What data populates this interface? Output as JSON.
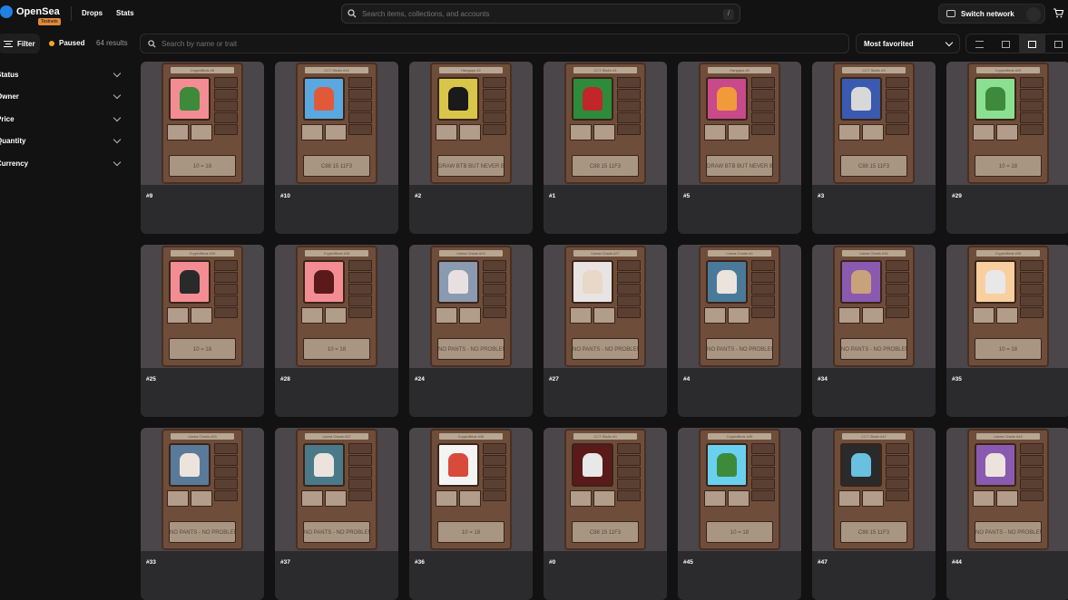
{
  "header": {
    "brand": "OpenSea",
    "badge": "Testnets",
    "nav": [
      "Drops",
      "Stats"
    ],
    "search_placeholder": "Search items, collections, and accounts",
    "search_shortcut": "/",
    "switch_network": "Switch network"
  },
  "toolbar": {
    "filter_label": "Filter",
    "status_label": "Paused",
    "results": "64 results",
    "search_placeholder": "Search by name or trait",
    "sort_label": "Most favorited",
    "status_color": "#f5a623"
  },
  "sidebar": {
    "items": [
      "Status",
      "Owner",
      "Price",
      "Quantity",
      "Currency"
    ]
  },
  "items": [
    {
      "name": "#9",
      "title": "CryptoBirdz #9",
      "plate": "10 = 18",
      "bg": "#f48c94",
      "fig": "#3d8a3a"
    },
    {
      "name": "#10",
      "title": "CCT Skullz #10",
      "plate": "C88 15 11F3",
      "bg": "#5aa8e0",
      "fig": "#e05a3a"
    },
    {
      "name": "#2",
      "title": "Hangups #2",
      "plate": "DRAW BTB BUT NEVER BONE",
      "bg": "#d8c64a",
      "fig": "#1a1a1a"
    },
    {
      "name": "#1",
      "title": "CCT Skullz #1",
      "plate": "C88 15 11F3",
      "bg": "#2e8b3a",
      "fig": "#c0262a"
    },
    {
      "name": "#5",
      "title": "Hangups #5",
      "plate": "DRAW BTB BUT NEVER BONE",
      "bg": "#c84a8a",
      "fig": "#f09a3a"
    },
    {
      "name": "#3",
      "title": "CCT Skullz #3",
      "plate": "C88 15 11F3",
      "bg": "#3a5ab0",
      "fig": "#d8d8d8"
    },
    {
      "name": "#29",
      "title": "CryptoBirdz #29",
      "plate": "10 = 18",
      "bg": "#8ae090",
      "fig": "#3d8a3a"
    },
    {
      "name": "#25",
      "title": "CryptoBirdz #25",
      "plate": "10 = 18",
      "bg": "#f48c94",
      "fig": "#2a2a2a"
    },
    {
      "name": "#28",
      "title": "CryptoBirdz #28",
      "plate": "10 = 18",
      "bg": "#f48c94",
      "fig": "#5a1a1a"
    },
    {
      "name": "#24",
      "title": "Llama Chads #24",
      "plate": "NO PANTS - NO PROBLEMS",
      "bg": "#8a9ab0",
      "fig": "#e8e0e0"
    },
    {
      "name": "#27",
      "title": "Llama Chads #27",
      "plate": "NO PANTS - NO PROBLEMS",
      "bg": "#e8e4e4",
      "fig": "#e8d8c8"
    },
    {
      "name": "#4",
      "title": "Llama Chads #4",
      "plate": "NO PANTS - NO PROBLEMS",
      "bg": "#4a7a9a",
      "fig": "#ece4dc"
    },
    {
      "name": "#34",
      "title": "Llama Chads #34",
      "plate": "NO PANTS - NO PROBLEMS",
      "bg": "#8a5ab0",
      "fig": "#c8a27a"
    },
    {
      "name": "#35",
      "title": "CryptoBirdz #35",
      "plate": "10 = 18",
      "bg": "#f8d0a0",
      "fig": "#e8e8e8"
    },
    {
      "name": "#33",
      "title": "Llama Chads #33",
      "plate": "NO PANTS - NO PROBLEMS",
      "bg": "#5a7a9a",
      "fig": "#ece4dc"
    },
    {
      "name": "#37",
      "title": "Llama Chads #37",
      "plate": "NO PANTS - NO PROBLEMS",
      "bg": "#4a7a8a",
      "fig": "#ece4dc"
    },
    {
      "name": "#36",
      "title": "CryptoBirdz #36",
      "plate": "10 = 18",
      "bg": "#f4f4f4",
      "fig": "#d84a3a"
    },
    {
      "name": "#0",
      "title": "CCT Skullz #0",
      "plate": "C88 15 11F3",
      "bg": "#5a1a1a",
      "fig": "#e8e8e8"
    },
    {
      "name": "#45",
      "title": "CryptoBirdz #45",
      "plate": "10 = 18",
      "bg": "#6ad0f0",
      "fig": "#3d8a3a"
    },
    {
      "name": "#47",
      "title": "CCT Skullz #47",
      "plate": "C88 15 11F3",
      "bg": "#2a2a2a",
      "fig": "#6ac0e0"
    },
    {
      "name": "#44",
      "title": "Llama Chads #44",
      "plate": "NO PANTS - NO PROBLEMS",
      "bg": "#8a5ab0",
      "fig": "#ece4dc"
    }
  ]
}
